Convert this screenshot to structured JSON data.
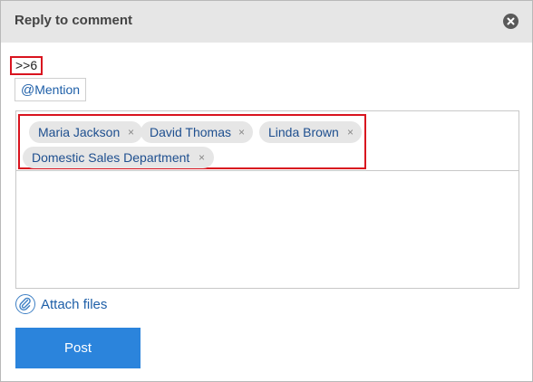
{
  "dialog": {
    "title": "Reply to comment",
    "close_icon": "close-circle-icon"
  },
  "reply_ref": ">>6",
  "mention_button": {
    "at": "@",
    "label": "Mention"
  },
  "mentions": [
    {
      "name": "Maria Jackson",
      "remove": "×"
    },
    {
      "name": "David Thomas",
      "remove": "×"
    },
    {
      "name": "Linda Brown",
      "remove": "×"
    },
    {
      "name": "Domestic Sales Department",
      "remove": "×"
    }
  ],
  "comment_text": "",
  "attach": {
    "icon": "paperclip-icon",
    "label": "Attach files"
  },
  "post_button": "Post",
  "colors": {
    "accent": "#2b84dc",
    "link": "#1e5fa8",
    "highlight": "#d9141f",
    "header_bg": "#e6e6e6",
    "tag_bg": "#e6e6e6"
  }
}
